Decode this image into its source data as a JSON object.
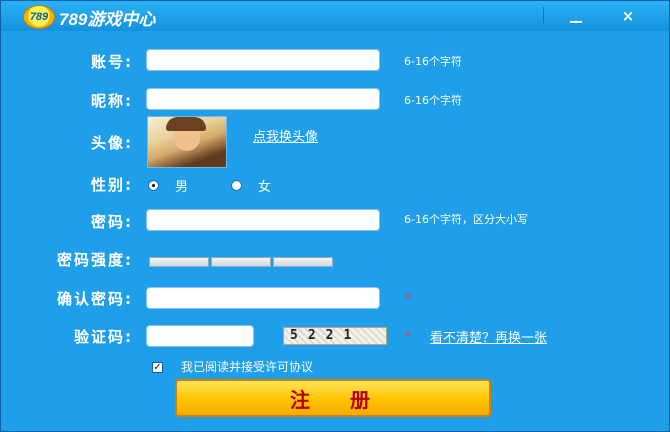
{
  "window": {
    "title": "789游戏中心",
    "logo_text": "789",
    "minimize": "_",
    "close": "×"
  },
  "form": {
    "account_label": "账号:",
    "account_hint": "6-16个字符",
    "nickname_label": "昵称:",
    "nickname_hint": "6-16个字符",
    "avatar_label": "头像:",
    "change_avatar_link": "点我换头像",
    "gender_label": "性别:",
    "gender_male": "男",
    "gender_female": "女",
    "gender_selected": "男",
    "password_label": "密码:",
    "password_hint": "6-16个字符，区分大小写",
    "strength_label": "密码强度:",
    "confirm_label": "确认密码:",
    "required_marker": "*",
    "captcha_label": "验证码:",
    "captcha_text": "5221",
    "refresh_captcha_link": "看不清楚？再换一张",
    "agree_text": "我已阅读并接受许可协议",
    "agree_checked": true,
    "register_button": "注册"
  }
}
